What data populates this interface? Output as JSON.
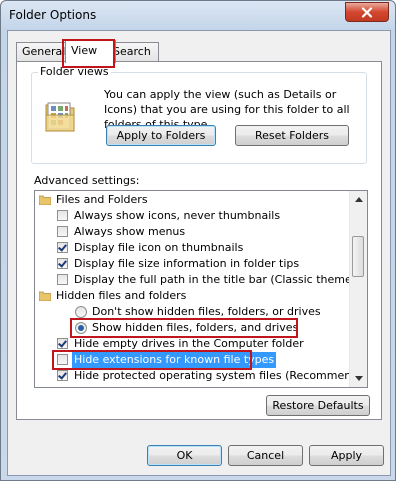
{
  "window": {
    "title": "Folder Options"
  },
  "tabs": [
    {
      "label": "General"
    },
    {
      "label": "View"
    },
    {
      "label": "Search"
    }
  ],
  "folder_views": {
    "legend": "Folder views",
    "description": "You can apply the view (such as Details or Icons) that you are using for this folder to all folders of this type.",
    "apply_button": "Apply to Folders",
    "reset_button": "Reset Folders"
  },
  "advanced": {
    "label": "Advanced settings:",
    "items": [
      {
        "kind": "folder",
        "label": "Files and Folders",
        "checked": false
      },
      {
        "kind": "checkbox",
        "label": "Always show icons, never thumbnails",
        "checked": false
      },
      {
        "kind": "checkbox",
        "label": "Always show menus",
        "checked": false
      },
      {
        "kind": "checkbox",
        "label": "Display file icon on thumbnails",
        "checked": true
      },
      {
        "kind": "checkbox",
        "label": "Display file size information in folder tips",
        "checked": true
      },
      {
        "kind": "checkbox",
        "label": "Display the full path in the title bar (Classic theme only)",
        "checked": false
      },
      {
        "kind": "folder",
        "label": "Hidden files and folders",
        "checked": false
      },
      {
        "kind": "radio",
        "label": "Don't show hidden files, folders, or drives",
        "checked": false
      },
      {
        "kind": "radio",
        "label": "Show hidden files, folders, and drives",
        "checked": true
      },
      {
        "kind": "checkbox",
        "label": "Hide empty drives in the Computer folder",
        "checked": true
      },
      {
        "kind": "checkbox",
        "label": "Hide extensions for known file types",
        "checked": false
      },
      {
        "kind": "checkbox",
        "label": "Hide protected operating system files (Recommended)",
        "checked": true
      }
    ]
  },
  "restore_button": "Restore Defaults",
  "footer": {
    "ok": "OK",
    "cancel": "Cancel",
    "apply": "Apply"
  },
  "colors": {
    "highlight_box": "#c0161b",
    "selection": "#3399ff"
  }
}
